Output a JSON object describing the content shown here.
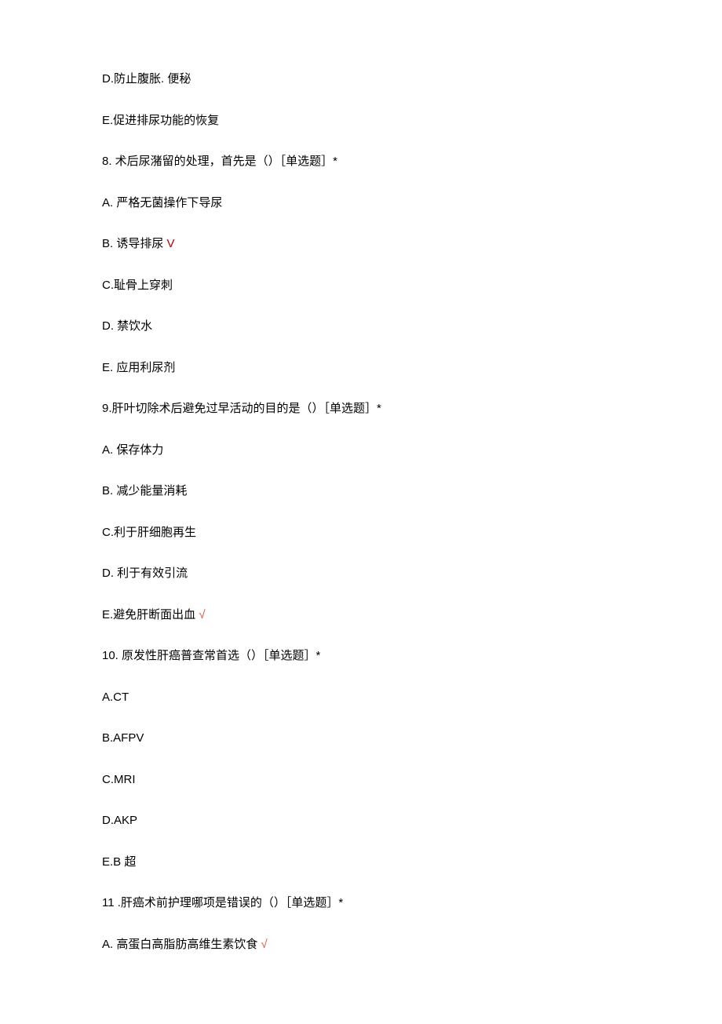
{
  "items": [
    {
      "text": "D.防止腹胀. 便秘",
      "mark": ""
    },
    {
      "text": "E.促进排尿功能的恢复",
      "mark": ""
    },
    {
      "text": "8. 术后尿潴留的处理，首先是（）［单选题］*",
      "mark": ""
    },
    {
      "text": "A. 严格无菌操作下导尿",
      "mark": ""
    },
    {
      "text": "B. 诱导排尿 ",
      "mark": "V",
      "markClass": "correct"
    },
    {
      "text": "C.耻骨上穿刺",
      "mark": ""
    },
    {
      "text": "D. 禁饮水",
      "mark": ""
    },
    {
      "text": "E. 应用利尿剂",
      "mark": ""
    },
    {
      "text": "9.肝叶切除术后避免过早活动的目的是（）［单选题］*",
      "mark": ""
    },
    {
      "text": "A. 保存体力",
      "mark": ""
    },
    {
      "text": "B. 减少能量消耗",
      "mark": ""
    },
    {
      "text": "C.利于肝细胞再生",
      "mark": ""
    },
    {
      "text": "D. 利于有效引流",
      "mark": ""
    },
    {
      "text": "E.避免肝断面出血 ",
      "mark": "√",
      "markClass": "correct-alt"
    },
    {
      "text": "10. 原发性肝癌普查常首选（）［单选题］*",
      "mark": ""
    },
    {
      "text": "A.CT",
      "mark": ""
    },
    {
      "text": "B.AFPV",
      "mark": ""
    },
    {
      "text": "C.MRI",
      "mark": ""
    },
    {
      "text": "D.AKP",
      "mark": ""
    },
    {
      "text": "E.B 超",
      "mark": ""
    },
    {
      "text": "11 .肝癌术前护理哪项是错误的（）［单选题］*",
      "mark": ""
    },
    {
      "text": "A. 高蛋白高脂肪高维生素饮食 ",
      "mark": "√",
      "markClass": "correct-alt"
    }
  ]
}
